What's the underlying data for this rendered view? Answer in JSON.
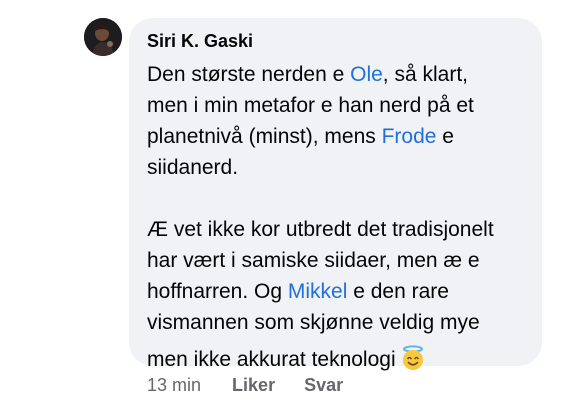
{
  "comment": {
    "author": "Siri K. Gaski",
    "para1": {
      "t1": "Den største nerden e ",
      "m1": "Ole",
      "t2": ", så klart,",
      "t3": "men i min metafor e han nerd på et",
      "t4": "planetnivå (minst), mens ",
      "m2": "Frode",
      "t5": " e",
      "t6": "siidanerd."
    },
    "para2": {
      "t1": "Æ vet ikke kor utbredt det tradisjonelt",
      "t2": "har vært i samiske siidaer, men æ e",
      "t3": "hoffnarren. Og ",
      "m1": "Mikkel",
      "t4": " e den rare",
      "t5": "vismannen som skjønne veldig mye",
      "t6": "men ikke akkurat teknologi"
    },
    "emoji": "smiling-face-with-halo",
    "colors": {
      "mention": "#216fdb",
      "bubble": "#f0f2f5",
      "meta": "#65676b"
    }
  },
  "actions": {
    "time": "13 min",
    "like": "Liker",
    "reply": "Svar"
  }
}
